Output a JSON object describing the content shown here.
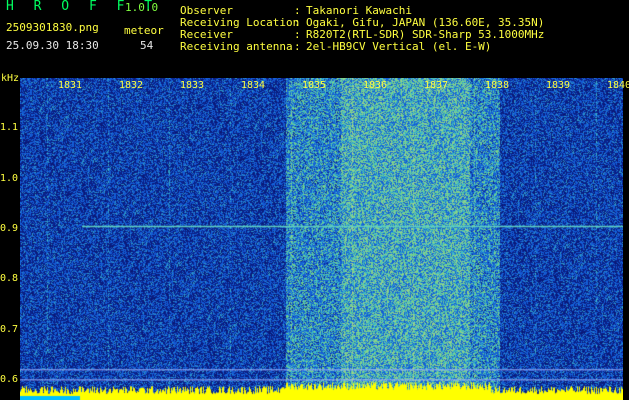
{
  "header": {
    "app_title": "H R O F F T",
    "app_version": "1.0.0",
    "filename": "2509301830.png",
    "datetime": "25.09.30 18:30",
    "meteor_label": "meteor",
    "meteor_count": "54",
    "info": [
      {
        "label": "Observer",
        "value": "Takanori Kawachi"
      },
      {
        "label": "Receiving Location",
        "value": "Ogaki, Gifu, JAPAN (136.60E, 35.35N)"
      },
      {
        "label": "Receiver",
        "value": "R820T2(RTL-SDR) SDR-Sharp 53.1000MHz"
      },
      {
        "label": "Receiving antenna",
        "value": "2el-HB9CV Vertical (el. E-W)"
      }
    ],
    "colon": ":"
  },
  "chart_data": {
    "type": "heatmap",
    "title": "",
    "xlabel": "",
    "ylabel": "kHz",
    "x_ticks": [
      "1831",
      "1832",
      "1833",
      "1834",
      "1835",
      "1836",
      "1837",
      "1838",
      "1839",
      "1840"
    ],
    "y_ticks": [
      "1.1",
      "1.0",
      "0.9",
      "0.8",
      "0.7",
      "0.6"
    ],
    "ylim": [
      0.56,
      1.2
    ],
    "colormap": [
      "#0a1a6e",
      "#1030a0",
      "#2050d0",
      "#30a0c0",
      "#60d0a0",
      "#ffff00"
    ],
    "signals": [
      {
        "name": "",
        "time_start": "1831",
        "time_end": "1840",
        "freq_khz": 0.905
      }
    ]
  },
  "colors": {
    "header_yellow": "#ffff40",
    "header_cyan": "#00ffff",
    "title_green": "#00ff60"
  }
}
